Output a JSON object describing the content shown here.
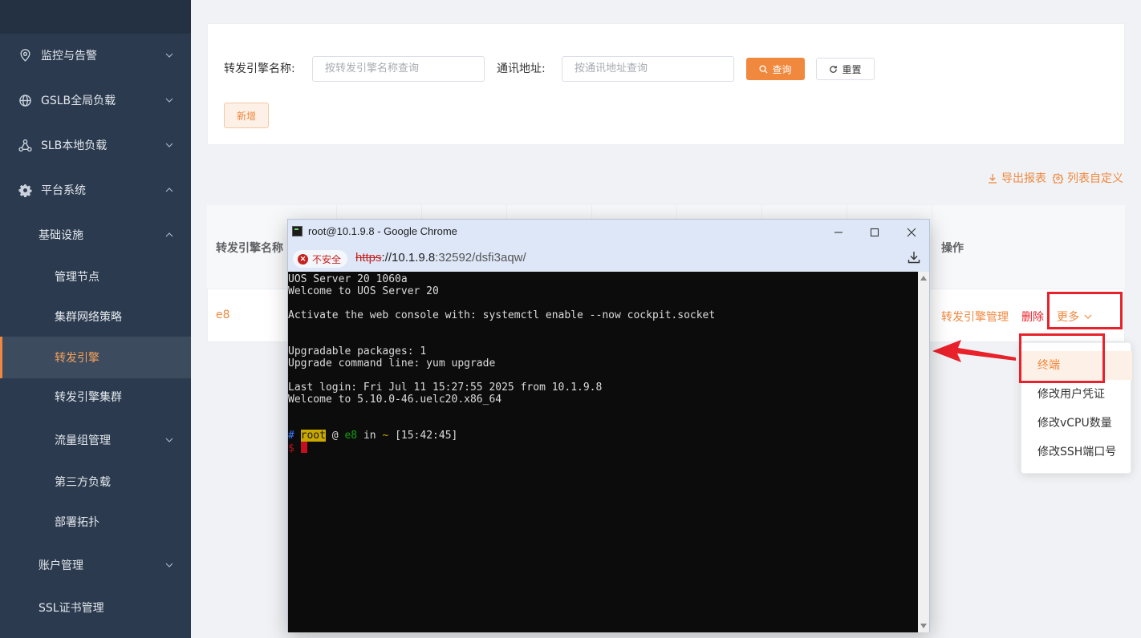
{
  "sidebar": {
    "items": [
      {
        "label": "监控与告警",
        "icon": "location-icon"
      },
      {
        "label": "GSLB全局负载",
        "icon": "globe-icon"
      },
      {
        "label": "SLB本地负载",
        "icon": "network-icon"
      },
      {
        "label": "平台系统",
        "icon": "gear-icon"
      },
      {
        "label": "基础设施"
      },
      {
        "label": "管理节点"
      },
      {
        "label": "集群网络策略"
      },
      {
        "label": "转发引擎"
      },
      {
        "label": "转发引擎集群"
      },
      {
        "label": "流量组管理"
      },
      {
        "label": "第三方负载"
      },
      {
        "label": "部署拓扑"
      },
      {
        "label": "账户管理"
      },
      {
        "label": "SSL证书管理"
      }
    ],
    "active": "转发引擎"
  },
  "search": {
    "name_label": "转发引擎名称:",
    "name_placeholder": "按转发引擎名称查询",
    "addr_label": "通讯地址:",
    "addr_placeholder": "按通讯地址查询",
    "query_button": "查询",
    "reset_button": "重置",
    "add_button": "新增"
  },
  "toolbar": {
    "export": "导出报表",
    "customize": "列表自定义"
  },
  "table": {
    "col_name": "转发引擎名称",
    "col_action": "操作",
    "row": {
      "name": "e8",
      "action_manage": "转发引擎管理",
      "action_delete": "删除",
      "action_more": "更多"
    }
  },
  "more_menu": {
    "items": [
      "终端",
      "修改用户凭证",
      "修改vCPU数量",
      "修改SSH端口号"
    ],
    "highlighted": "终端"
  },
  "browser": {
    "title": "root@10.1.9.8 - Google Chrome",
    "insecure": "不安全",
    "url_proto": "https",
    "url_host": "://10.1.9.8",
    "url_rest": ":32592/dsfi3aqw/"
  },
  "terminal": {
    "lines": [
      "UOS Server 20 1060a",
      "Welcome to UOS Server 20",
      "Activate the web console with: systemctl enable --now cockpit.socket",
      "Upgradable packages: 1",
      "Upgrade command line: yum upgrade",
      "Last login: Fri Jul 11 15:27:55 2025 from 10.1.9.8",
      "Welcome to 5.10.0-46.uelc20.x86_64"
    ],
    "prompt_hash": "#",
    "prompt_user": "root",
    "prompt_at": "@",
    "prompt_host": "e8",
    "prompt_in": "in",
    "prompt_dir": "~",
    "prompt_time": "[15:42:45]",
    "prompt_dollar": "$"
  },
  "colors": {
    "accent": "#f0883e",
    "sidebar_bg": "#2b3a4e",
    "annotation_red": "#e8212a"
  }
}
